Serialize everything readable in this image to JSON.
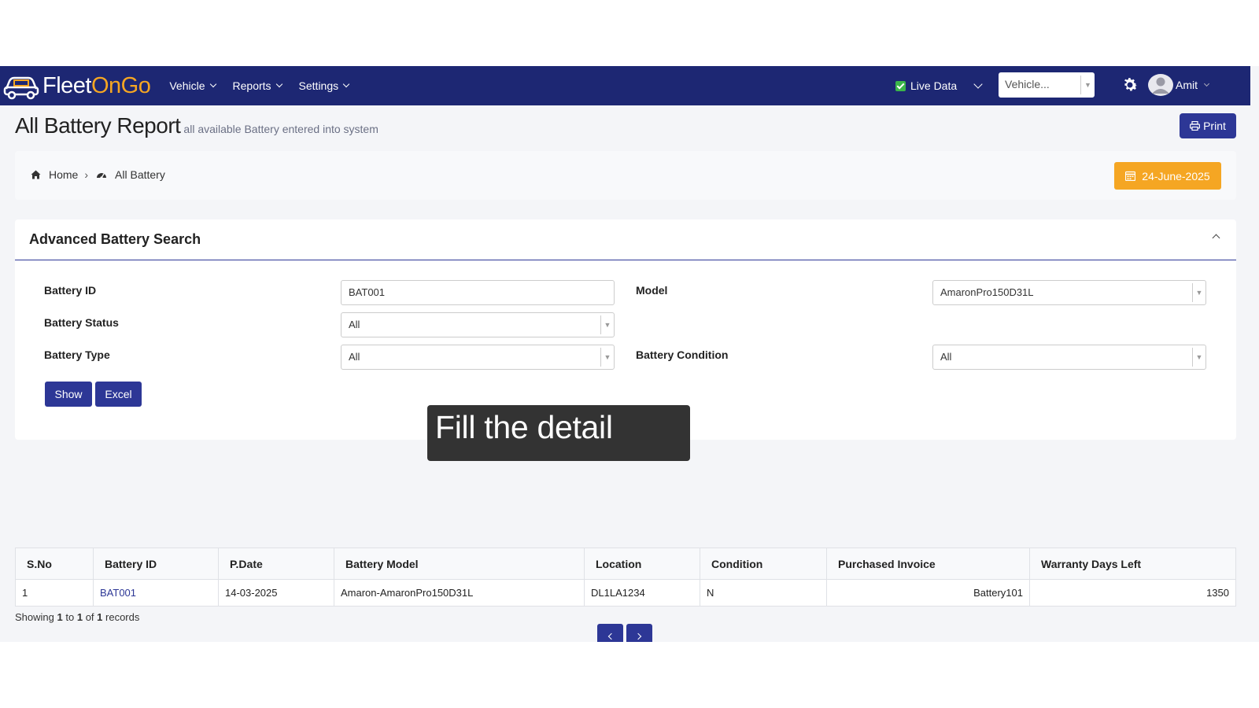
{
  "brand": {
    "part1": "Fleet",
    "part2": "OnGo",
    "accent": "#f5a623",
    "navbar_color": "#1d2773"
  },
  "nav": {
    "items": [
      {
        "label": "Vehicle"
      },
      {
        "label": "Reports"
      },
      {
        "label": "Settings"
      }
    ],
    "live_data_label": "Live Data",
    "vehicle_select": "Vehicle...",
    "user_name": "Amit"
  },
  "page": {
    "title": "All Battery Report",
    "subtitle": "all available Battery entered into system",
    "print_label": "Print"
  },
  "breadcrumb": {
    "home": "Home",
    "current": "All Battery",
    "date": "24-June-2025"
  },
  "search": {
    "heading": "Advanced Battery Search",
    "battery_id_label": "Battery ID",
    "battery_id_value": "BAT001",
    "model_label": "Model",
    "model_value": "AmaronPro150D31L",
    "status_label": "Battery Status",
    "status_value": "All",
    "type_label": "Battery Type",
    "type_value": "All",
    "condition_label": "Battery Condition",
    "condition_value": "All",
    "show_label": "Show",
    "excel_label": "Excel"
  },
  "tooltip": "Fill the detail",
  "table": {
    "headers": [
      "S.No",
      "Battery ID",
      "P.Date",
      "Battery Model",
      "Location",
      "Condition",
      "Purchased Invoice",
      "Warranty Days Left"
    ],
    "rows": [
      [
        "1",
        "BAT001",
        "14-03-2025",
        "Amaron-AmaronPro150D31L",
        "DL1LA1234",
        "N",
        "Battery101",
        "1350"
      ]
    ]
  },
  "records": {
    "prefix": "Showing",
    "from": "1",
    "to_word": "to",
    "to": "1",
    "of_word": "of",
    "total": "1",
    "suffix": "records"
  }
}
